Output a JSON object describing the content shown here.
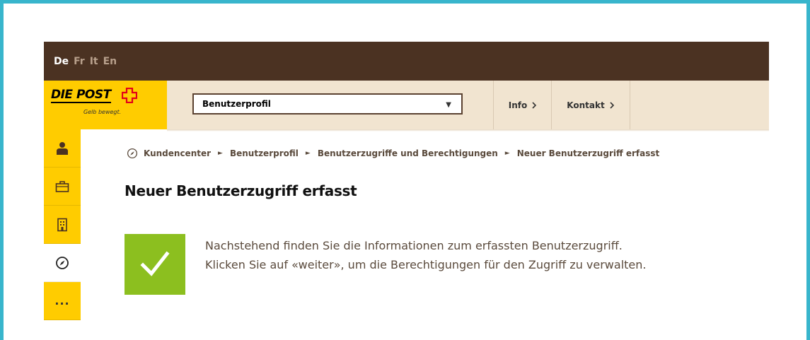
{
  "languages": [
    {
      "code": "De",
      "active": true
    },
    {
      "code": "Fr",
      "active": false
    },
    {
      "code": "It",
      "active": false
    },
    {
      "code": "En",
      "active": false
    }
  ],
  "logo": {
    "name": "DIE POST",
    "tagline": "Gelb bewegt."
  },
  "header": {
    "select_value": "Benutzerprofil",
    "nav": [
      {
        "label": "Info",
        "icon": "chevron-right-icon"
      },
      {
        "label": "Kontakt",
        "icon": "chevron-right-icon"
      }
    ]
  },
  "sidebar": {
    "items": [
      {
        "icon": "person-icon"
      },
      {
        "icon": "briefcase-icon"
      },
      {
        "icon": "building-icon"
      },
      {
        "icon": "compass-icon",
        "active": true
      },
      {
        "label": "..."
      }
    ]
  },
  "breadcrumb": [
    "Kundencenter",
    "Benutzerprofil",
    "Benutzerzugriffe und Berechtigungen",
    "Neuer Benutzerzugriff erfasst"
  ],
  "page_title": "Neuer Benutzerzugriff erfasst",
  "success": {
    "icon": "checkmark-icon",
    "line1": "Nachstehend finden Sie die Informationen zum erfassten Benutzerzugriff.",
    "line2": "Klicken Sie auf «weiter», um die Berechtigungen für den Zugriff zu verwalten."
  },
  "colors": {
    "brand_yellow": "#ffcc00",
    "header_brown": "#4b3222",
    "success_green": "#8cbf1f",
    "frame_teal": "#38b5cc"
  }
}
